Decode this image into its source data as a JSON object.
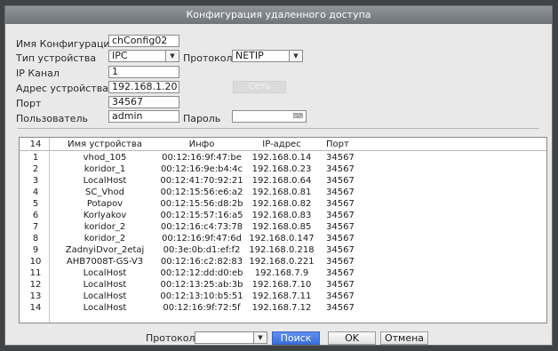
{
  "dialog": {
    "title": "Конфигурация удаленного доступа"
  },
  "form": {
    "config_name_label": "Имя Конфигурации",
    "config_name_value": "chConfig02",
    "device_type_label": "Тип устройства",
    "device_type_value": "IPC",
    "protocol_label": "Протокол",
    "protocol_value": "NETIP",
    "channel_label": "IP Канал",
    "channel_value": "1",
    "address_label": "Адрес устройства",
    "address_value": "192.168.1.20",
    "network_button": "Сеть",
    "port_label": "Порт",
    "port_value": "34567",
    "user_label": "Пользователь",
    "user_value": "admin",
    "password_label": "Пароль"
  },
  "table": {
    "header": {
      "count": "14",
      "name": "Имя устройства",
      "info": "Инфо",
      "ip": "IP-адрес",
      "port": "Порт"
    },
    "rows": [
      {
        "num": "1",
        "name": "vhod_105",
        "info": "00:12:16:9f:47:be",
        "ip": "192.168.0.14",
        "port": "34567"
      },
      {
        "num": "2",
        "name": "koridor_1",
        "info": "00:12:16:9e:b4:4c",
        "ip": "192.168.0.23",
        "port": "34567"
      },
      {
        "num": "3",
        "name": "LocalHost",
        "info": "00:12:41:70:92:21",
        "ip": "192.168.0.64",
        "port": "34567"
      },
      {
        "num": "4",
        "name": "SC_Vhod",
        "info": "00:12:15:56:e6:a2",
        "ip": "192.168.0.81",
        "port": "34567"
      },
      {
        "num": "5",
        "name": "Potapov",
        "info": "00:12:15:56:d8:2b",
        "ip": "192.168.0.82",
        "port": "34567"
      },
      {
        "num": "6",
        "name": "Korlyakov",
        "info": "00:12:15:57:16:a5",
        "ip": "192.168.0.83",
        "port": "34567"
      },
      {
        "num": "7",
        "name": "koridor_2",
        "info": "00:12:16:c4:73:78",
        "ip": "192.168.0.85",
        "port": "34567"
      },
      {
        "num": "8",
        "name": "koridor_2",
        "info": "00:12:16:9f:47:6d",
        "ip": "192.168.0.147",
        "port": "34567"
      },
      {
        "num": "9",
        "name": "ZadnyiDvor_2etaj",
        "info": "00:3e:0b:d1:ef:f2",
        "ip": "192.168.0.218",
        "port": "34567"
      },
      {
        "num": "10",
        "name": "AHB7008T-GS-V3",
        "info": "00:12:16:c2:82:83",
        "ip": "192.168.0.221",
        "port": "34567"
      },
      {
        "num": "11",
        "name": "LocalHost",
        "info": "00:12:12:dd:d0:eb",
        "ip": "192.168.7.9",
        "port": "34567"
      },
      {
        "num": "12",
        "name": "LocalHost",
        "info": "00:12:13:25:ab:3b",
        "ip": "192.168.7.10",
        "port": "34567"
      },
      {
        "num": "13",
        "name": "LocalHost",
        "info": "00:12:13:10:b5:51",
        "ip": "192.168.7.11",
        "port": "34567"
      },
      {
        "num": "14",
        "name": "LocalHost",
        "info": "00:12:16:9f:72:5f",
        "ip": "192.168.7.12",
        "port": "34567"
      }
    ]
  },
  "footer": {
    "protocol_label": "Протокол",
    "protocol_value": "",
    "search_button": "Поиск",
    "ok_button": "OK",
    "cancel_button": "Отмена"
  }
}
